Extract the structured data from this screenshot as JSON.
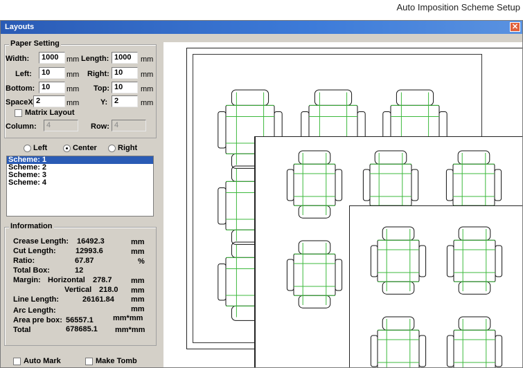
{
  "caption": "Auto Imposition Scheme Setup",
  "window": {
    "title": "Layouts",
    "close_glyph": "✕"
  },
  "paper": {
    "title": "Paper Setting",
    "width_label": "Width:",
    "width": "1000",
    "width_unit": "mm",
    "length_label": "Length:",
    "length": "1000",
    "length_unit": "mm",
    "left_label": "Left:",
    "left": "10",
    "left_unit": "mm",
    "right_label": "Right:",
    "right": "10",
    "right_unit": "mm",
    "bottom_label": "Bottom:",
    "bottom": "10",
    "bottom_unit": "mm",
    "top_label": "Top:",
    "top": "10",
    "top_unit": "mm",
    "spacex_label": "SpaceX:",
    "spacex": "2",
    "spacex_unit": "mm",
    "y_label": "Y:",
    "y": "2",
    "y_unit": "mm",
    "matrix_label": "Matrix Layout",
    "column_label": "Column:",
    "column": "4",
    "row_label": "Row:",
    "row": "4"
  },
  "alignment": {
    "left": "Left",
    "center": "Center",
    "right": "Right",
    "selected": "Center"
  },
  "schemes": [
    "Scheme: 1",
    "Scheme: 2",
    "Scheme: 3",
    "Scheme: 4"
  ],
  "info": {
    "title": "Information",
    "crease_label": "Crease Length:",
    "crease": "16492.3",
    "crease_unit": "mm",
    "cut_label": "Cut Length:",
    "cut": "12993.6",
    "cut_unit": "mm",
    "ratio_label": "Ratio:",
    "ratio": "67.87",
    "ratio_unit": "%",
    "total_box_label": "Total Box:",
    "total_box": "12",
    "margin_label": "Margin:",
    "horizontal_label": "Horizontal",
    "horizontal": "278.7",
    "horizontal_unit": "mm",
    "vertical_label": "Vertical",
    "vertical": "218.0",
    "vertical_unit": "mm",
    "line_label": "Line Length:",
    "line": "26161.84",
    "line_unit": "mm",
    "arc_label": "Arc Length:",
    "arc_unit": "mm",
    "area_label": "Area pre box:",
    "area": "56557.1",
    "area_unit": "mm*mm",
    "total_label": "Total",
    "total": "678685.1",
    "total_unit": "mm*mm"
  },
  "footer": {
    "auto_mark": "Auto Mark",
    "make_tomb": "Make Tomb"
  },
  "colors": {
    "crease": "#3cb93c",
    "cut": "#111111",
    "selection": "#2a5bb5"
  }
}
